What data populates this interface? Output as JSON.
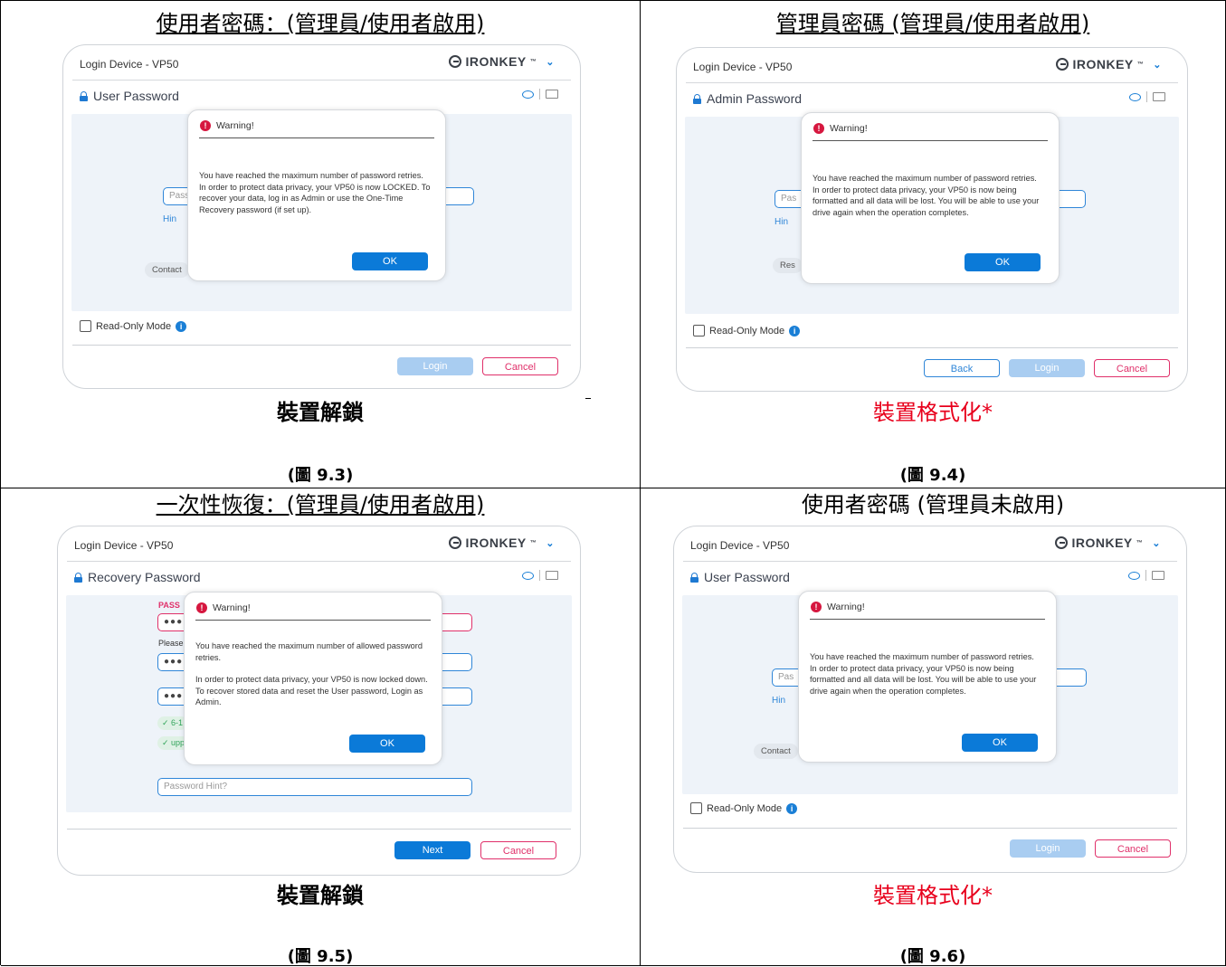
{
  "figures": [
    {
      "heading": "使用者密碼：(管理員/使用者啟用)",
      "heading_underline": true,
      "app": {
        "title": "Login Device - VP50",
        "brand": "IRONKEY",
        "section": "User Password",
        "field_placeholder": "Pass",
        "hint_text": "Hin",
        "ghost_button": "Contact",
        "read_only_label": "Read-Only Mode",
        "buttons": [
          "Login",
          "Cancel"
        ]
      },
      "dialog": {
        "title": "Warning!",
        "message": "You have reached the maximum number of password retries. In order to protect data privacy, your VP50 is now LOCKED. To recover your data, log in as Admin or use the One-Time Recovery password (if set up).",
        "ok": "OK"
      },
      "status": "裝置解鎖",
      "status_color": "#000000",
      "label": "(圖 9.3)"
    },
    {
      "heading": "管理員密碼 (管理員/使用者啟用)",
      "heading_underline": true,
      "app": {
        "title": "Login Device - VP50",
        "brand": "IRONKEY",
        "section": "Admin Password",
        "field_placeholder": "Pas",
        "hint_text": "Hin",
        "ghost_button": "Res",
        "read_only_label": "Read-Only Mode",
        "buttons": [
          "Back",
          "Login",
          "Cancel"
        ]
      },
      "dialog": {
        "title": "Warning!",
        "message": "You have reached the maximum number of password retries. In order to protect data privacy, your VP50 is now being formatted and all data will be lost. You will be able to use your drive again when the operation completes.",
        "ok": "OK"
      },
      "status": "裝置格式化*",
      "status_color": "#e8001c",
      "label": "(圖 9.4)"
    },
    {
      "heading": "一次性恢復：(管理員/使用者啟用)",
      "heading_underline": true,
      "app": {
        "title": "Login Device - VP50",
        "brand": "IRONKEY",
        "section": "Recovery Password",
        "pass_label": "PASS",
        "please_label": "Please",
        "dots": "●●●",
        "green1": "✓ 6-1",
        "green2": "✓ upp",
        "hint_placeholder": "Password Hint?",
        "buttons": [
          "Next",
          "Cancel"
        ]
      },
      "dialog": {
        "title": "Warning!",
        "message1": "You have reached the maximum number of allowed password retries.",
        "message2": "In order to protect data privacy, your VP50 is now locked down. To recover stored data and reset the User password, Login as Admin.",
        "ok": "OK"
      },
      "status": "裝置解鎖",
      "status_color": "#000000",
      "label": "(圖 9.5)"
    },
    {
      "heading": "使用者密碼 (管理員未啟用)",
      "heading_underline": false,
      "app": {
        "title": "Login Device - VP50",
        "brand": "IRONKEY",
        "section": "User Password",
        "field_placeholder": "Pas",
        "hint_text": "Hin",
        "ghost_button": "Contact",
        "read_only_label": "Read-Only Mode",
        "buttons": [
          "Login",
          "Cancel"
        ]
      },
      "dialog": {
        "title": "Warning!",
        "message": "You have reached the maximum number of password retries. In order to protect data privacy, your VP50 is now being formatted and all data will be lost. You will be able to use your drive again when the operation completes.",
        "ok": "OK"
      },
      "status": "裝置格式化*",
      "status_color": "#e8001c",
      "label": "(圖 9.6)"
    }
  ]
}
